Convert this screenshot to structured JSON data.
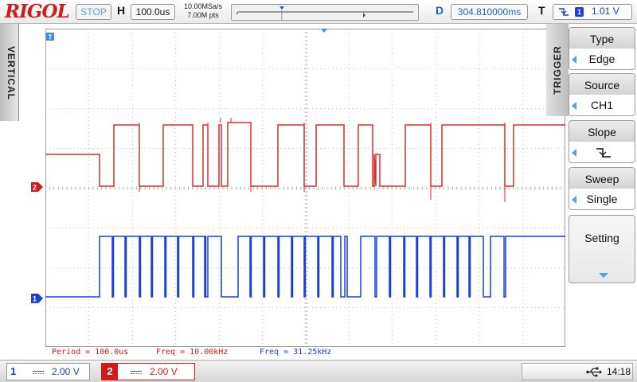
{
  "header": {
    "logo": "RIGOL",
    "status": "STOP",
    "h_label": "H",
    "timebase": "100.0us",
    "sample_rate": "10.00MSa/s",
    "memory_depth": "7.00M pts",
    "d_label": "D",
    "delay": "304.810000ms",
    "t_label": "T",
    "trigger_channel": "1",
    "trigger_level": "1.01 V"
  },
  "left_tab": {
    "label": "VERTICAL"
  },
  "trigger_menu": {
    "tab_label": "TRIGGER",
    "items": [
      {
        "title": "Type",
        "value": "Edge"
      },
      {
        "title": "Source",
        "value": "CH1"
      },
      {
        "title": "Slope",
        "value": ""
      },
      {
        "title": "Sweep",
        "value": "Single"
      }
    ],
    "setting_label": "Setting"
  },
  "measurements": {
    "period": "Period = 100.0us",
    "freq_ch2": "Freq = 10.00kHz",
    "freq_ch1": "Freq = 31.25kHz"
  },
  "channels": {
    "ch1": {
      "number": "1",
      "scale": "2.00 V",
      "color": "#1a3fd6",
      "marker": "1"
    },
    "ch2": {
      "number": "2",
      "scale": "2.00 V",
      "color": "#d21a1a",
      "marker": "2"
    }
  },
  "status_bar": {
    "time": "14:18"
  },
  "icons": {
    "trigger_slope": "falling-edge-icon",
    "usb": "usb-icon"
  }
}
